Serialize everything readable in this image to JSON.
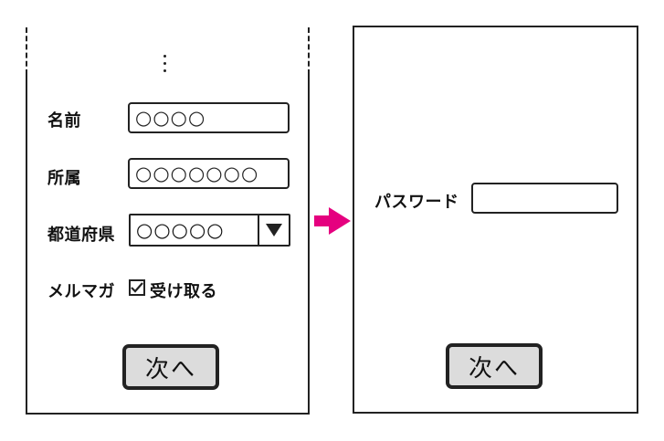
{
  "left_screen": {
    "fields": [
      {
        "label": "名前",
        "value": "○○○○"
      },
      {
        "label": "所属",
        "value": "○○○○○○○"
      }
    ],
    "prefecture": {
      "label": "都道府県",
      "value": "○○○○○"
    },
    "newsletter": {
      "label": "メルマガ",
      "checkbox_label": "受け取る",
      "checked": true
    },
    "next_button": "次へ"
  },
  "right_screen": {
    "password_label": "パスワード",
    "password_value": "",
    "next_button": "次へ"
  },
  "colors": {
    "flow_arrow": "#e5007f",
    "button_bg": "#dcdcdc",
    "stroke": "#222222"
  }
}
